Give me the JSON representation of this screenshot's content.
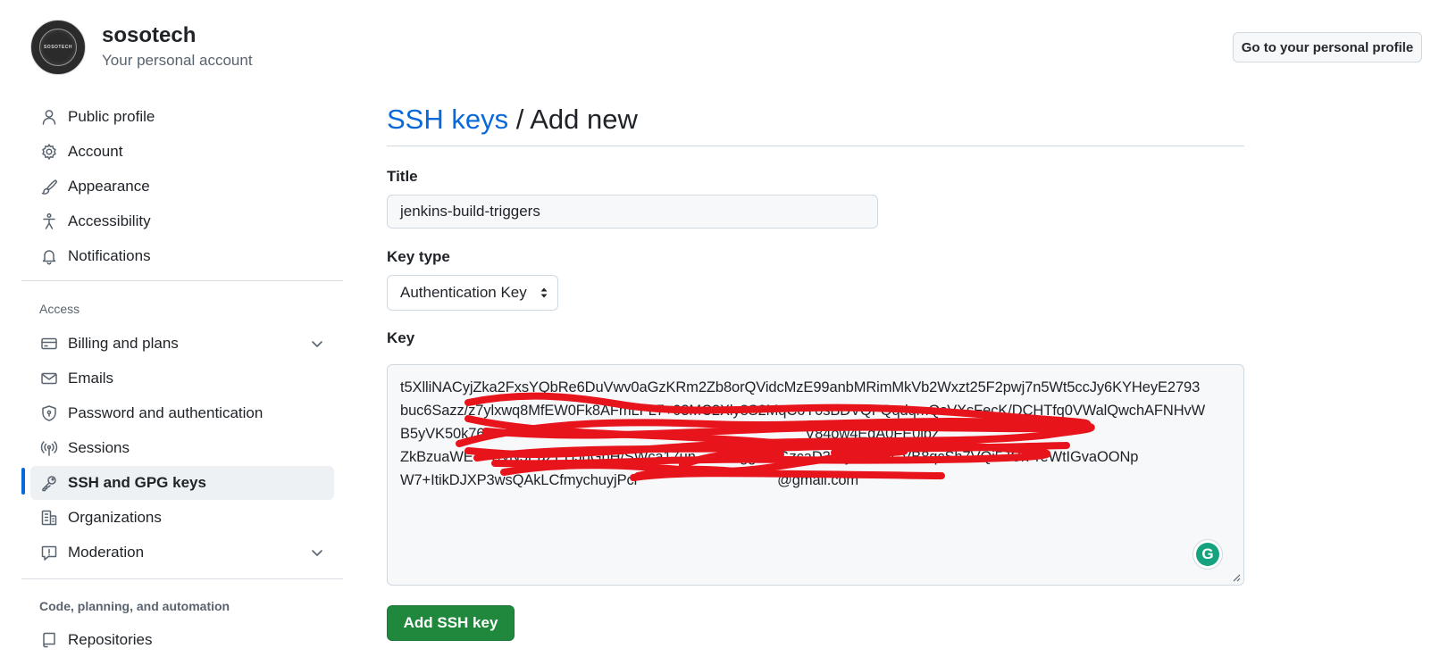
{
  "account": {
    "avatar_text": "SOSOTECH",
    "name": "sosotech",
    "subtitle": "Your personal account",
    "profile_button": "Go to your personal profile"
  },
  "sidebar": {
    "items": [
      {
        "label": "Public profile",
        "icon": "person-icon"
      },
      {
        "label": "Account",
        "icon": "gear-icon"
      },
      {
        "label": "Appearance",
        "icon": "paintbrush-icon"
      },
      {
        "label": "Accessibility",
        "icon": "accessibility-icon"
      },
      {
        "label": "Notifications",
        "icon": "bell-icon"
      }
    ],
    "access_heading": "Access",
    "access_items": [
      {
        "label": "Billing and plans",
        "icon": "credit-card-icon"
      },
      {
        "label": "Emails",
        "icon": "mail-icon"
      },
      {
        "label": "Password and authentication",
        "icon": "shield-lock-icon"
      },
      {
        "label": "Sessions",
        "icon": "broadcast-icon"
      },
      {
        "label": "SSH and GPG keys",
        "icon": "key-icon"
      },
      {
        "label": "Organizations",
        "icon": "organization-icon"
      },
      {
        "label": "Moderation",
        "icon": "report-icon"
      }
    ],
    "code_heading": "Code, planning, and automation",
    "code_items": [
      {
        "label": "Repositories",
        "icon": "repo-icon"
      }
    ],
    "active": "SSH and GPG keys"
  },
  "main": {
    "breadcrumb_link": "SSH keys",
    "breadcrumb_separator": " / ",
    "breadcrumb_current": "Add new",
    "title_label": "Title",
    "title_value": "jenkins-build-triggers",
    "key_type_label": "Key type",
    "key_type_value": "Authentication Key",
    "key_label": "Key",
    "key_lines": [
      "t5XlliNACyjZka2FxsYQbRe6DuVwv0aGzKRm2Zb8orQVidcMzE99anbMRimMkVb2Wxzt25F2pwj7n5Wt5ccJy6KYHeyE2793",
      "buc6Sazz/z7ylxwq8MfEW0Fk8AFmLFL7+03MC2Xly8S2MqC6Y0sBDVQFQqdqmQsVXsFecK/DCHTfq0VWalQwchAFNHvW",
      "B5yVK50k760                                                                              V84ow4EqA0FE0ibz",
      "ZkBzuaWE    T/yN5PaZEHJgGbH/SWca17un           ggxxsGzcaD3l6lybFHx/CVB8qcSh7VQi5JCrPreWtIGvaOONp",
      "W7+ItikDJXP3wsQAkLCfmychuyjPcl                                   @gmail.com"
    ],
    "submit_label": "Add SSH key",
    "grammarly_letter": "G"
  },
  "colors": {
    "link": "#0969da",
    "primary_button": "#1f883d",
    "redaction": "#e8141b"
  }
}
